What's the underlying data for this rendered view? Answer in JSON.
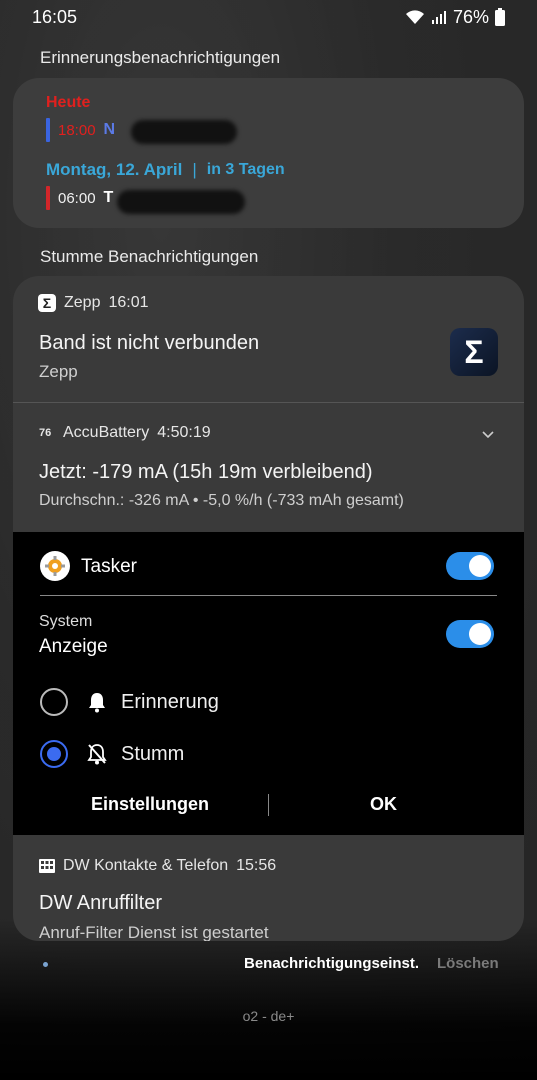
{
  "status": {
    "time": "16:05",
    "battery": "76%"
  },
  "sections": {
    "reminders_title": "Erinnerungsbenachrichtigungen",
    "silent_title": "Stumme Benachrichtigungen"
  },
  "reminders": {
    "today_label": "Heute",
    "today_time": "18:00",
    "today_initial": "N",
    "date_label": "Montag, 12. April",
    "separator": "|",
    "relative": "in 3 Tagen",
    "date_time": "06:00",
    "date_initial": "T"
  },
  "zepp": {
    "app_name": "Zepp",
    "time": "16:01",
    "title": "Band ist nicht verbunden",
    "subtitle": "Zepp",
    "icon_glyph": "Σ"
  },
  "accubattery": {
    "icon_text": "76",
    "app_name": "AccuBattery",
    "time": "4:50:19",
    "title": "Jetzt: -179 mA (15h 19m verbleibend)",
    "subtitle": "Durchschn.: -326 mA • -5,0 %/h (-733 mAh gesamt)"
  },
  "tasker": {
    "app_name": "Tasker",
    "category_small": "System",
    "category": "Anzeige",
    "option_alert": "Erinnerung",
    "option_silent": "Stumm",
    "selected": "Stumm",
    "settings_button": "Einstellungen",
    "ok_button": "OK"
  },
  "dw": {
    "app_name": "DW Kontakte & Telefon",
    "time": "15:56",
    "title": "DW Anruffilter",
    "subtitle": "Anruf-Filter Dienst ist gestartet"
  },
  "footer": {
    "settings": "Benachrichtigungseinst.",
    "clear": "Löschen",
    "carrier": "o2 - de+"
  },
  "colors": {
    "accent_blue": "#2b8ee9",
    "today_red": "#e0201e",
    "date_blue": "#3aa7d8"
  }
}
